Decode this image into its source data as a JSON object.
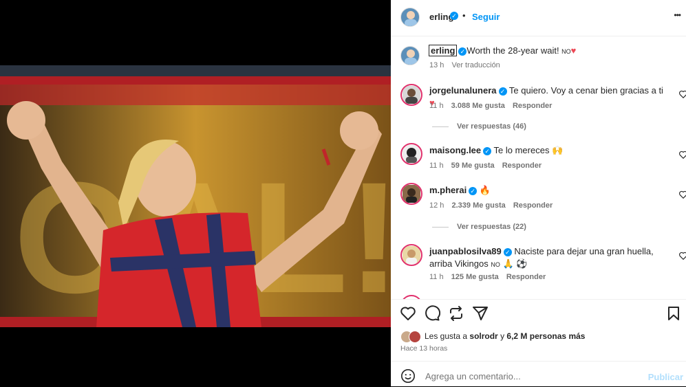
{
  "post": {
    "author": "erling",
    "follow_label": "Seguir",
    "more_label": "•••"
  },
  "caption": {
    "username": "erling",
    "text": "Worth the 28-year wait! ",
    "flag_text": "NO",
    "time": "13 h",
    "translate_label": "Ver traducción"
  },
  "comments": [
    {
      "username": "jorgelunalunera",
      "text": "Te quiero. Voy a cenar bien gracias a ti ",
      "time": "11 h",
      "likes": "3.088 Me gusta",
      "reply_label": "Responder",
      "replies": "Ver respuestas (46)"
    },
    {
      "username": "maisong.lee",
      "text": "Te lo mereces 🙌",
      "time": "11 h",
      "likes": "59 Me gusta",
      "reply_label": "Responder"
    },
    {
      "username": "m.pherai",
      "text": "🔥",
      "time": "12 h",
      "likes": "2.339 Me gusta",
      "reply_label": "Responder",
      "replies": "Ver respuestas (22)"
    },
    {
      "username": "juanpablosilva89",
      "text": "Naciste para dejar una gran huella, arriba Vikingos ",
      "flag_text": "NO",
      "extra_emoji": "🙏 ⚽",
      "time": "11 h",
      "likes": "125 Me gusta",
      "reply_label": "Responder"
    }
  ],
  "likes_summary": {
    "prefix": "Les gusta a ",
    "user": "solrodr",
    "middle": " y ",
    "count": "6,2 M personas más"
  },
  "post_time": "Hace 13 horas",
  "add_comment": {
    "placeholder": "Agrega un comentario...",
    "publish_label": "Publicar"
  },
  "colors": {
    "verified": "#0095f6",
    "link": "#0095f6",
    "muted": "#737373",
    "heart": "#ed4956",
    "publish_disabled": "#b2dffc"
  }
}
